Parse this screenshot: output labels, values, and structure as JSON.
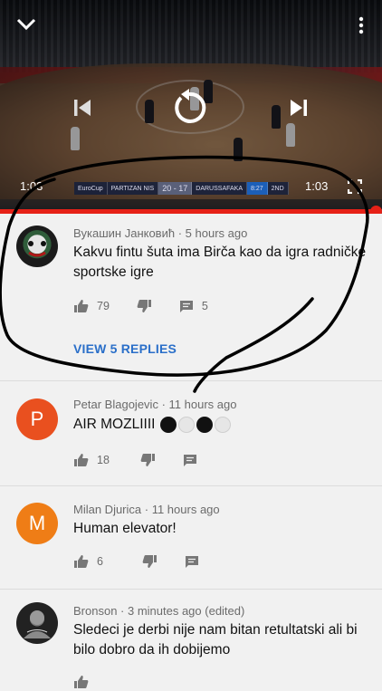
{
  "player": {
    "time_left": "1:03",
    "time_right": "1:03",
    "progress_fraction": 0.985,
    "scorebug": {
      "league": "EuroCup",
      "home": "PARTIZAN NIS",
      "score": "20 - 17",
      "away": "DARUSSAFAKA",
      "clock": "8:27",
      "quarter": "2ND"
    },
    "icons": {
      "collapse": "chevron-down-icon",
      "menu": "more-vert-icon",
      "previous": "skip-previous-icon",
      "replay": "replay-icon",
      "next": "skip-next-icon",
      "fullscreen": "fullscreen-icon"
    }
  },
  "comments": [
    {
      "author": "Вукашин Јанковић",
      "time": "5 hours ago",
      "text": "Kakvu fintu šuta ima Birča kao da igra radničke sportske igre",
      "likes": "79",
      "replies_count": "5",
      "view_replies": "VIEW 5 REPLIES",
      "avatar_kind": "image"
    },
    {
      "author": "Petar Blagojevic",
      "time": "11 hours ago",
      "text": "AIR MOZLIIII",
      "likes": "18",
      "avatar_letter": "P",
      "avatar_color": "#e9501f"
    },
    {
      "author": "Milan Djurica",
      "time": "11 hours ago",
      "text": "Human elevator!",
      "likes": "6",
      "avatar_letter": "M",
      "avatar_color": "#ef7d16"
    },
    {
      "author": "Bronson",
      "time": "3 minutes ago (edited)",
      "text": "Sledeci je derbi nije nam bitan retultatski ali bi bilo dobro da ih dobijemo",
      "avatar_kind": "image"
    }
  ],
  "colors": {
    "accent_red": "#e62117",
    "link_blue": "#2a6fc9",
    "background": "#f1f1f1"
  }
}
